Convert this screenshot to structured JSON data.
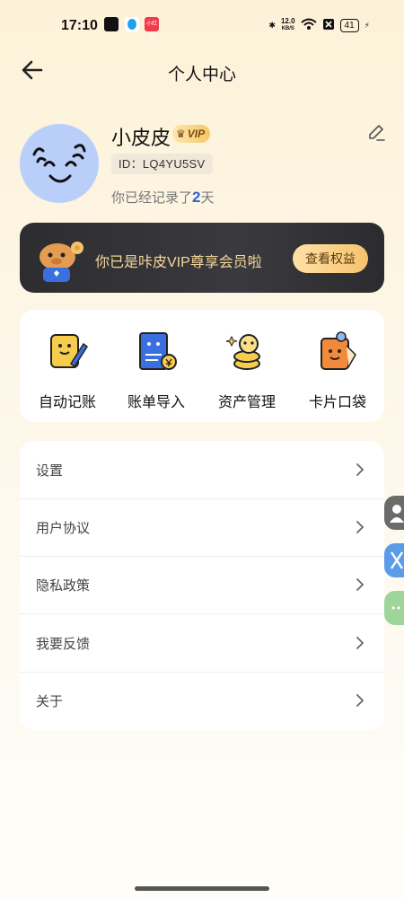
{
  "status": {
    "time": "17:10",
    "net_speed_value": "12.0",
    "net_speed_unit": "KB/S",
    "battery": "41",
    "redbook_label": "小红书"
  },
  "nav": {
    "title": "个人中心"
  },
  "profile": {
    "nickname": "小皮皮",
    "vip_label": "VIP",
    "id_text": "ID：LQ4YU5SV",
    "days_prefix": "你已经记录了",
    "days_count": "2",
    "days_suffix": "天"
  },
  "vip_banner": {
    "text": "你已是咔皮VIP尊享会员啦",
    "button": "查看权益"
  },
  "quick_actions": [
    {
      "label": "自动记账",
      "icon": "notebook-pen-icon"
    },
    {
      "label": "账单导入",
      "icon": "bill-import-icon"
    },
    {
      "label": "资产管理",
      "icon": "coins-stack-icon"
    },
    {
      "label": "卡片口袋",
      "icon": "card-pocket-icon"
    }
  ],
  "menu": [
    {
      "label": "设置"
    },
    {
      "label": "用户协议"
    },
    {
      "label": "隐私政策"
    },
    {
      "label": "我要反馈"
    },
    {
      "label": "关于"
    }
  ],
  "colors": {
    "accent": "#2f62d8",
    "vip_gold": "#f6c36d",
    "banner_dark": "#2d2d30"
  }
}
